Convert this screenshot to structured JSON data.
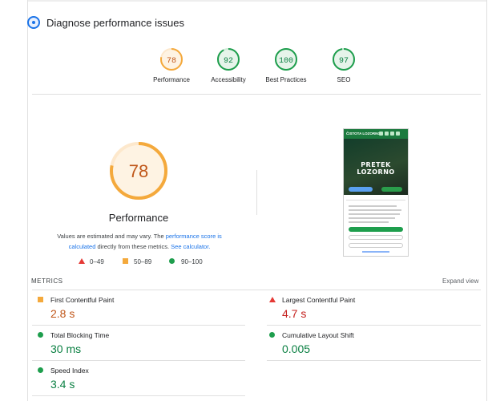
{
  "header": {
    "title": "Diagnose performance issues"
  },
  "gauges": [
    {
      "label": "Performance",
      "score": "78",
      "fraction": 0.78,
      "color": "#f4a93c",
      "text_color": "#c0571a"
    },
    {
      "label": "Accessibility",
      "score": "92",
      "fraction": 0.92,
      "color": "#1e9e4d",
      "text_color": "#0b8043"
    },
    {
      "label": "Best Practices",
      "score": "100",
      "fraction": 1.0,
      "color": "#1e9e4d",
      "text_color": "#0b8043"
    },
    {
      "label": "SEO",
      "score": "97",
      "fraction": 0.97,
      "color": "#1e9e4d",
      "text_color": "#0b8043"
    }
  ],
  "main": {
    "score": "78",
    "fraction": 0.78,
    "title": "Performance",
    "desc_1": "Values are estimated and may vary. The ",
    "desc_link_1": "performance score is calculated",
    "desc_2": " directly from these metrics. ",
    "desc_link_2": "See calculator.",
    "legend": {
      "fail": "0–49",
      "average": "50–89",
      "pass": "90–100"
    }
  },
  "preview": {
    "logo": "ČISTOTA LOZORNO",
    "title": "PRETEK LOZORNO"
  },
  "metrics": {
    "label": "METRICS",
    "expand": "Expand view",
    "fcp": {
      "name": "First Contentful Paint",
      "value": "2.8 s"
    },
    "lcp": {
      "name": "Largest Contentful Paint",
      "value": "4.7 s"
    },
    "tbt": {
      "name": "Total Blocking Time",
      "value": "30 ms"
    },
    "cls": {
      "name": "Cumulative Layout Shift",
      "value": "0.005"
    },
    "si": {
      "name": "Speed Index",
      "value": "3.4 s"
    }
  }
}
